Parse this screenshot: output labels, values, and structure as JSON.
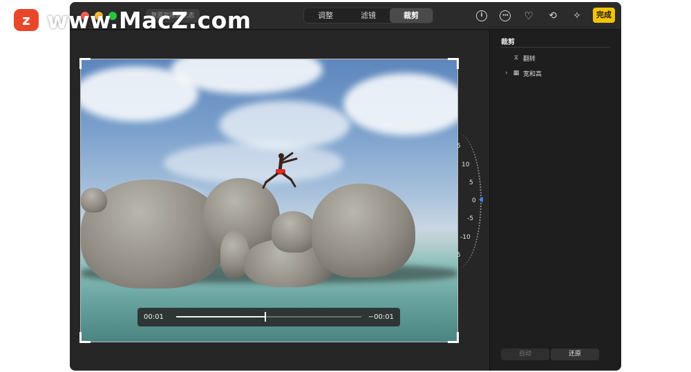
{
  "watermark": {
    "logo_letter": "z",
    "text": "www.MacZ.com"
  },
  "titlebar": {
    "revert_label": "复原到原始状态",
    "tabs": [
      {
        "label": "调整",
        "active": false
      },
      {
        "label": "滤镜",
        "active": false
      },
      {
        "label": "裁剪",
        "active": true
      }
    ],
    "icons": {
      "info": "info-icon",
      "more": "ellipsis-icon",
      "favorite": "heart-icon",
      "rotate": "rotate-icon",
      "enhance": "magic-wand-icon"
    },
    "info_glyph": "i",
    "more_glyph": "•••",
    "heart_glyph": "♡",
    "rotate_glyph": "⟲",
    "wand_glyph": "✧",
    "done_label": "完成",
    "done_color": "#f5c400"
  },
  "dial": {
    "labels": [
      "5",
      "10",
      "5",
      "0",
      "-5",
      "-10",
      "5"
    ],
    "current_value": 0,
    "pointer_color": "#2e8bff"
  },
  "video": {
    "elapsed": "00:01",
    "remaining": "−00:01",
    "progress_fraction": 0.48
  },
  "sidebar": {
    "title": "裁剪",
    "items": [
      {
        "label": "翻转",
        "icon": "flip-icon",
        "glyph": "⧖",
        "expandable": false
      },
      {
        "label": "宽和高",
        "icon": "aspect-ratio-icon",
        "glyph": "▦",
        "expandable": true,
        "chevron": "›"
      }
    ],
    "auto_label": "自动",
    "reset_label": "还原"
  }
}
